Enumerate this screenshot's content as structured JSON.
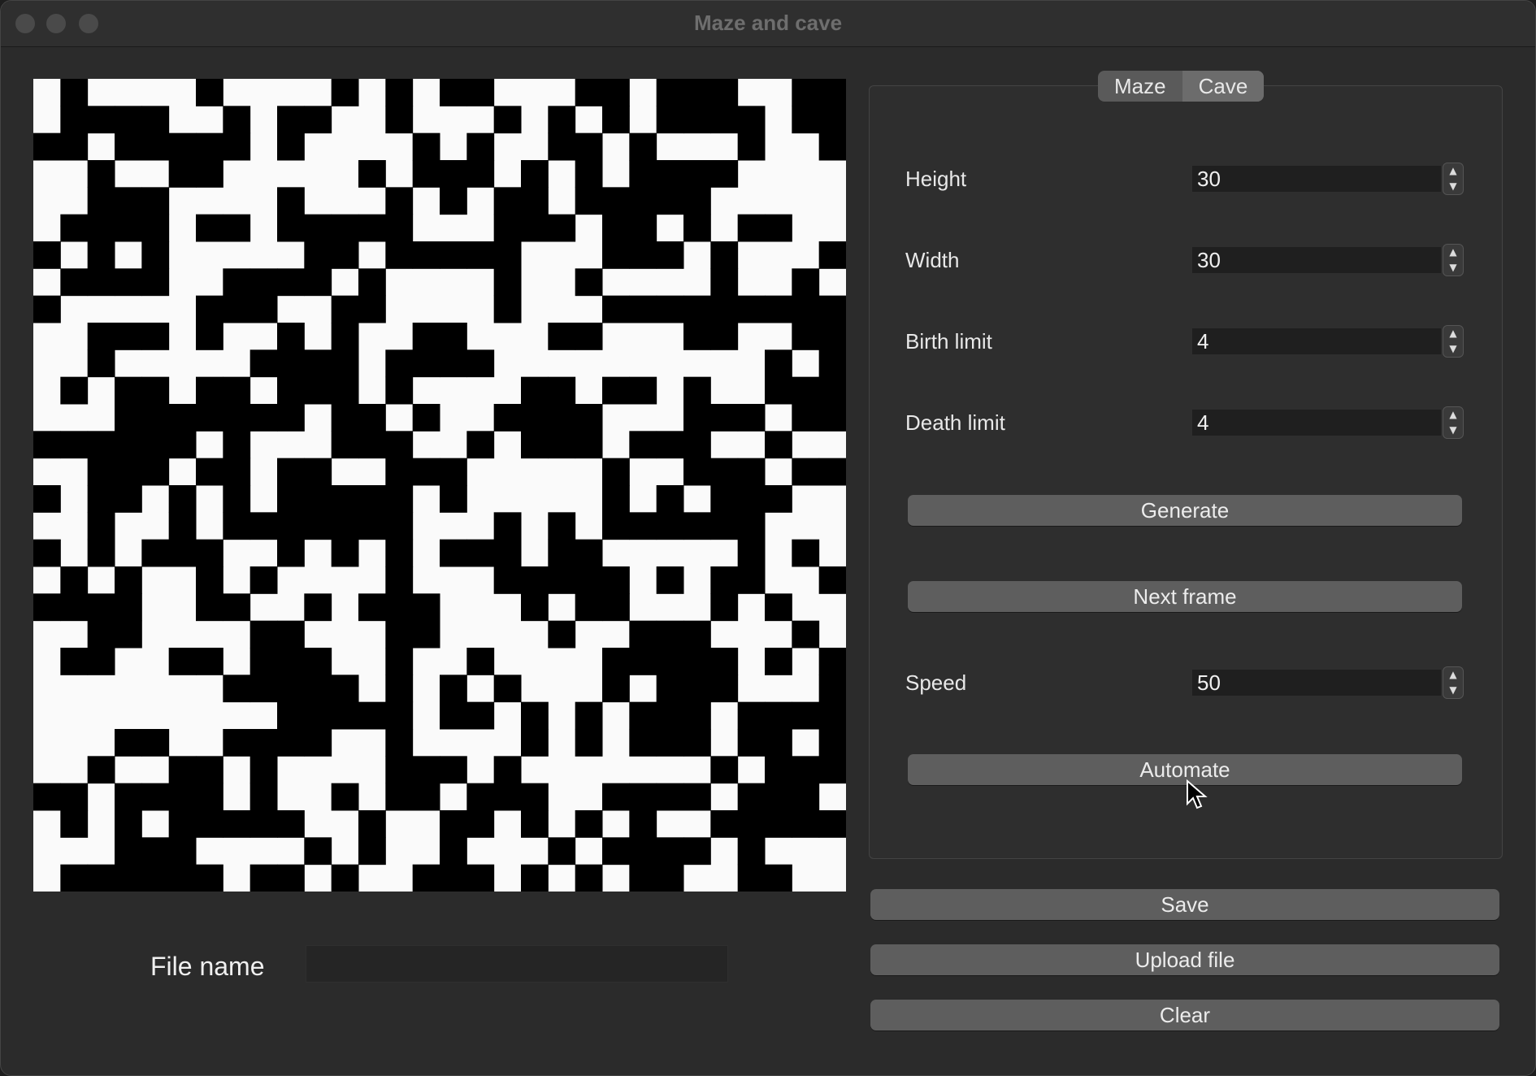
{
  "window": {
    "title": "Maze and cave"
  },
  "tabs": [
    {
      "label": "Maze",
      "active": false
    },
    {
      "label": "Cave",
      "active": true
    }
  ],
  "fields": {
    "height": {
      "label": "Height",
      "value": "30"
    },
    "width": {
      "label": "Width",
      "value": "30"
    },
    "birth_limit": {
      "label": "Birth limit",
      "value": "4"
    },
    "death_limit": {
      "label": "Death limit",
      "value": "4"
    },
    "speed": {
      "label": "Speed",
      "value": "50"
    }
  },
  "buttons": {
    "generate": "Generate",
    "next_frame": "Next frame",
    "automate": "Automate",
    "save": "Save",
    "upload": "Upload file",
    "clear": "Clear"
  },
  "file": {
    "label": "File name",
    "value": ""
  },
  "grid": {
    "rows": 30,
    "cols": 30,
    "wall_color": "#000000",
    "floor_color": "#fafafa"
  }
}
